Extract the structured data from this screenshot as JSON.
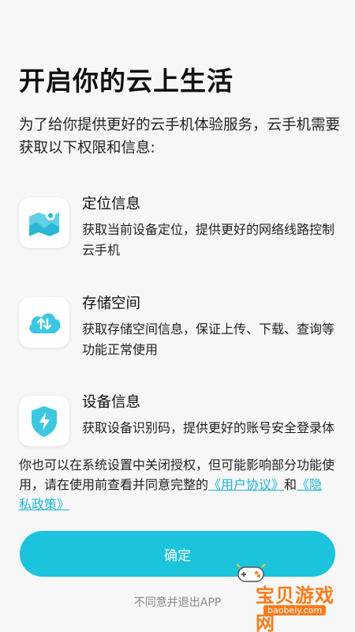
{
  "page": {
    "title": "开启你的云上生活",
    "intro": "为了给你提供更好的云手机体验服务，云手机需要获取以下权限和信息:"
  },
  "permissions": [
    {
      "icon": "location-map-icon",
      "title": "定位信息",
      "desc": "获取当前设备定位，提供更好的网络线路控制云手机"
    },
    {
      "icon": "cloud-storage-icon",
      "title": "存储空间",
      "desc": "获取存储空间信息，保证上传、下载、查询等功能正常使用"
    },
    {
      "icon": "security-shield-icon",
      "title": "设备信息",
      "desc": "获取设备识别码，提供更好的账号安全登录体"
    }
  ],
  "note": {
    "text": "你也可以在系统设置中关闭授权，但可能影响部分功能使用，请在使用前查看并同意完整的",
    "user_agreement": "《用户协议》",
    "and": "和",
    "privacy_policy": "《隐私政策》"
  },
  "actions": {
    "confirm": "确定",
    "exit": "不同意并退出APP"
  },
  "watermark": {
    "name": "宝贝游戏网",
    "url": "baobeiy.com"
  },
  "colors": {
    "accent": "#1cc3dc",
    "link": "#1fb6d6",
    "watermark": "#ff7a1a"
  }
}
